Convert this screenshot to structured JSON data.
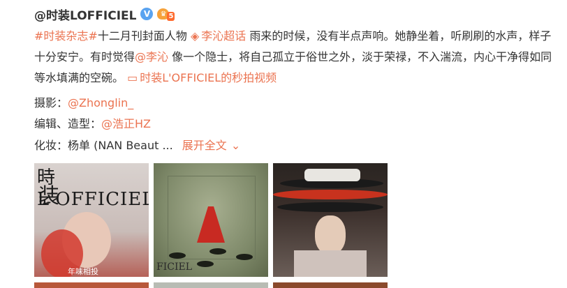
{
  "post": {
    "author": "@时装LOFFICIEL",
    "verified_icon": "v-badge-icon",
    "level": "5",
    "text": {
      "hashtag": "#时装杂志#",
      "t1": "十二月刊封面人物",
      "supertopic_icon": "diamond-icon",
      "supertopic": "李沁超话",
      "t2": " 雨来的时候，没有半点声响。她静坐着，听刷刷的水声，样子十分安宁。有时觉得",
      "mention1": "@李沁",
      "t3": " 像一个隐士，将自己孤立于俗世之外，淡于荣禄，不入湍流，内心干净得如同等水填满的空碗。",
      "video_icon": "video-icon",
      "video_link": "时装L'OFFICIEL的秒拍视频"
    },
    "credits": [
      {
        "label": "摄影：",
        "value": "@Zhonglin_"
      },
      {
        "label": "编辑、造型：",
        "value": "@浩正HZ"
      }
    ],
    "makeup": {
      "label": "化妆：",
      "value": "杨单 (NAN Beaut ...",
      "expand": "展开全文",
      "expand_icon": "chevron-down-icon"
    },
    "images": [
      {
        "mag_top": "時 L'OFFICIEL",
        "mag_cn": "装",
        "caption": "年味相投"
      },
      {
        "mag_bottom": "FICIEL"
      },
      {}
    ]
  }
}
